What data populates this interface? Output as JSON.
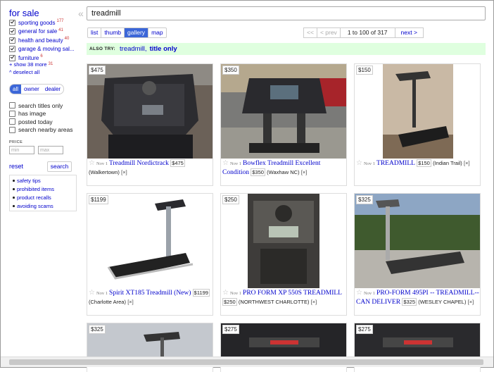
{
  "sidebar": {
    "title": "for sale",
    "categories": [
      {
        "label": "sporting goods",
        "count": "177"
      },
      {
        "label": "general for sale",
        "count": "41"
      },
      {
        "label": "health and beauty",
        "count": "40"
      },
      {
        "label": "garage & moving sal...",
        "count": ""
      },
      {
        "label": "furniture",
        "count": "6"
      }
    ],
    "show_more": "+ show 38 more",
    "show_more_count": "31",
    "deselect_all": "^ deselect all",
    "who": [
      "all",
      "owner",
      "dealer"
    ],
    "options": [
      "search titles only",
      "has image",
      "posted today",
      "search nearby areas"
    ],
    "price_label": "PRICE",
    "min_placeholder": "min",
    "max_placeholder": "max",
    "reset": "reset",
    "search": "search",
    "safety": [
      "safety tips",
      "prohibited items",
      "product recalls",
      "avoiding scams"
    ],
    "collapse_glyph": "«"
  },
  "search": {
    "query": "treadmill"
  },
  "views": [
    "list",
    "thumb",
    "gallery",
    "map"
  ],
  "pager": {
    "first": "<<",
    "prev": "< prev",
    "range": "1 to 100 of 317",
    "next": "next >"
  },
  "also_try": {
    "label": "ALSO TRY:",
    "query": "treadmill,",
    "title_only": "title only"
  },
  "results": [
    {
      "price": "$475",
      "date": "Nov 1",
      "title": "Treadmill Nordictrack",
      "location": "(Walkertown)",
      "hide": "[×]"
    },
    {
      "price": "$350",
      "date": "Nov 1",
      "title": "Bowflex Treadmill Excellent Condition",
      "location": "(Waxhaw NC)",
      "hide": "[×]"
    },
    {
      "price": "$150",
      "date": "Nov 1",
      "title": "TREADMILL",
      "location": "(Indian Trail)",
      "hide": "[×]"
    },
    {
      "price": "$1199",
      "date": "Nov 1",
      "title": "Spirit XT185 Treadmill (New)",
      "location": "(Charlotte Area)",
      "hide": "[×]"
    },
    {
      "price": "$250",
      "date": "Nov 1",
      "title": "PRO FORM XP 550S TREADMILL",
      "location": "(NORTHWEST CHARLOTTE)",
      "hide": "[×]"
    },
    {
      "price": "$325",
      "date": "Nov 1",
      "title": "PRO-FORM 495PI -- TREADMILL-- CAN DELIVER",
      "location": "(WESLEY CHAPEL)",
      "hide": "[×]"
    },
    {
      "price": "$325"
    },
    {
      "price": "$275"
    },
    {
      "price": "$275"
    }
  ],
  "colors": {
    "link": "#0000cc",
    "selected": "#3b66d8",
    "also_try_bg": "#dfffdf",
    "count": "#cc3333"
  }
}
